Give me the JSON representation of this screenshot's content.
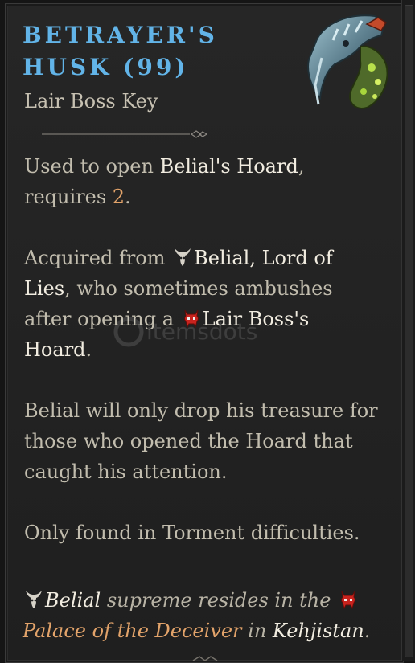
{
  "tooltip": {
    "title_line1": "BETRAYER'S",
    "title_line2": "HUSK (99)",
    "subtitle": "Lair Boss Key",
    "usage": {
      "prefix": "Used to open ",
      "hoard": "Belial's Hoard",
      "mid": ", requires ",
      "count": "2",
      "suffix": "."
    },
    "acquired": {
      "prefix": "Acquired from ",
      "boss": "Belial, Lord of Lies",
      "mid": ", who sometimes ambushes after opening a ",
      "lair": "Lair Boss's Hoard",
      "suffix": "."
    },
    "drop_note": "Belial will only drop his treasure for those who opened the Hoard that caught his attention.",
    "difficulty_note": "Only found in Torment difficulties.",
    "footer": {
      "boss": "Belial",
      "mid": " supreme resides in the ",
      "location": "Palace of the Deceiver",
      "in": " in ",
      "region": "Kehjistan",
      "suffix": "."
    },
    "watermark_text": "itemsdots"
  },
  "colors": {
    "title": "#62b4e8",
    "body": "#c2bdae",
    "highlight": "#f1ece0",
    "number": "#e2a36a",
    "location": "#e2a36a"
  },
  "icons": [
    "horned-skull-icon",
    "red-demon-icon",
    "betrayers-husk-icon"
  ]
}
